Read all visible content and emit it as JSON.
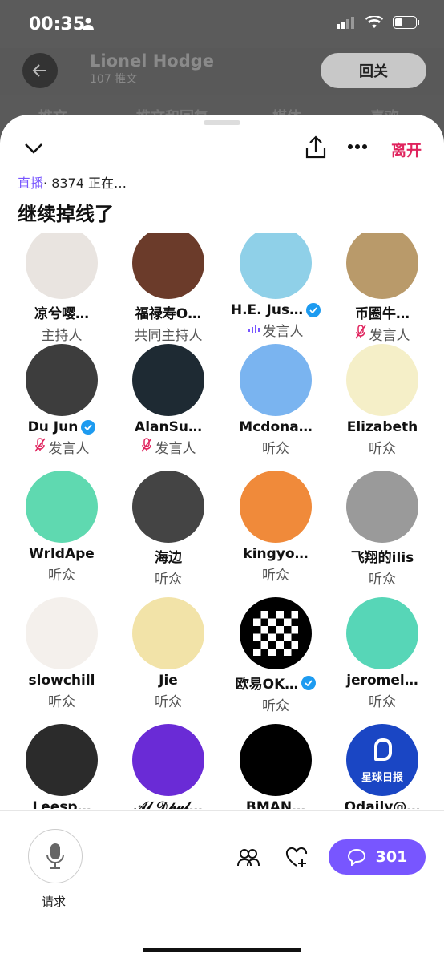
{
  "status": {
    "time": "00:35"
  },
  "background": {
    "name": "Lionel Hodge",
    "count": "107 推文",
    "follow": "回关",
    "tabs": [
      "推文",
      "推文和回复",
      "媒体",
      "喜欢"
    ]
  },
  "space": {
    "leave": "离开",
    "live_tag": "直播",
    "live_count": "· 8374 正在…",
    "title": "继续掉线了"
  },
  "participants": [
    {
      "name": "凉兮嘤…",
      "role": "主持人",
      "verified": false,
      "role_icon": "",
      "color": "#e9e4e0"
    },
    {
      "name": "福禄寿O…",
      "role": "共同主持人",
      "verified": false,
      "role_icon": "",
      "color": "#6b3b2a"
    },
    {
      "name": "H.E. Jus…",
      "role": "发言人",
      "verified": true,
      "role_icon": "speaking",
      "color": "#8fd0e8"
    },
    {
      "name": "币圈牛…",
      "role": "发言人",
      "verified": false,
      "role_icon": "muted",
      "color": "#b99a6a"
    },
    {
      "name": "Du Jun",
      "role": "发言人",
      "verified": true,
      "role_icon": "muted",
      "color": "#3d3d3d"
    },
    {
      "name": "AlanSu…",
      "role": "发言人",
      "verified": false,
      "role_icon": "muted",
      "color": "#1e2a33"
    },
    {
      "name": "Mcdona…",
      "role": "听众",
      "verified": false,
      "role_icon": "",
      "color": "#7ab4f0"
    },
    {
      "name": "Elizabeth",
      "role": "听众",
      "verified": false,
      "role_icon": "",
      "color": "#f5efc8"
    },
    {
      "name": "WrldApe",
      "role": "听众",
      "verified": false,
      "role_icon": "",
      "color": "#5fd9b0"
    },
    {
      "name": "海边",
      "role": "听众",
      "verified": false,
      "role_icon": "",
      "color": "#444"
    },
    {
      "name": "kingyo…",
      "role": "听众",
      "verified": false,
      "role_icon": "",
      "color": "#f08a3a"
    },
    {
      "name": "飞翔的ilis",
      "role": "听众",
      "verified": false,
      "role_icon": "",
      "color": "#9a9a9a"
    },
    {
      "name": "slowchill",
      "role": "听众",
      "verified": false,
      "role_icon": "",
      "color": "#f4f0ec"
    },
    {
      "name": "Jie",
      "role": "听众",
      "verified": false,
      "role_icon": "",
      "color": "#f2e3a8"
    },
    {
      "name": "欧易OK…",
      "role": "听众",
      "verified": true,
      "role_icon": "",
      "color": "#000"
    },
    {
      "name": "jeromel…",
      "role": "听众",
      "verified": false,
      "role_icon": "",
      "color": "#57d6b7"
    },
    {
      "name": "Leesp…",
      "role": "",
      "verified": false,
      "role_icon": "",
      "color": "#2b2b2b"
    },
    {
      "name": "𝒜𝓁 𝒟𝓅𝓊𝓁…",
      "role": "",
      "verified": false,
      "role_icon": "",
      "color": "#6a2bd6"
    },
    {
      "name": "BMAN…",
      "role": "",
      "verified": false,
      "role_icon": "",
      "color": "#000"
    },
    {
      "name": "Odaily@…",
      "role": "",
      "verified": false,
      "role_icon": "",
      "color": "#1a46c4"
    }
  ],
  "bottom": {
    "request_label": "请求",
    "comments": "301"
  },
  "odaily_logo_text": "星球日报"
}
